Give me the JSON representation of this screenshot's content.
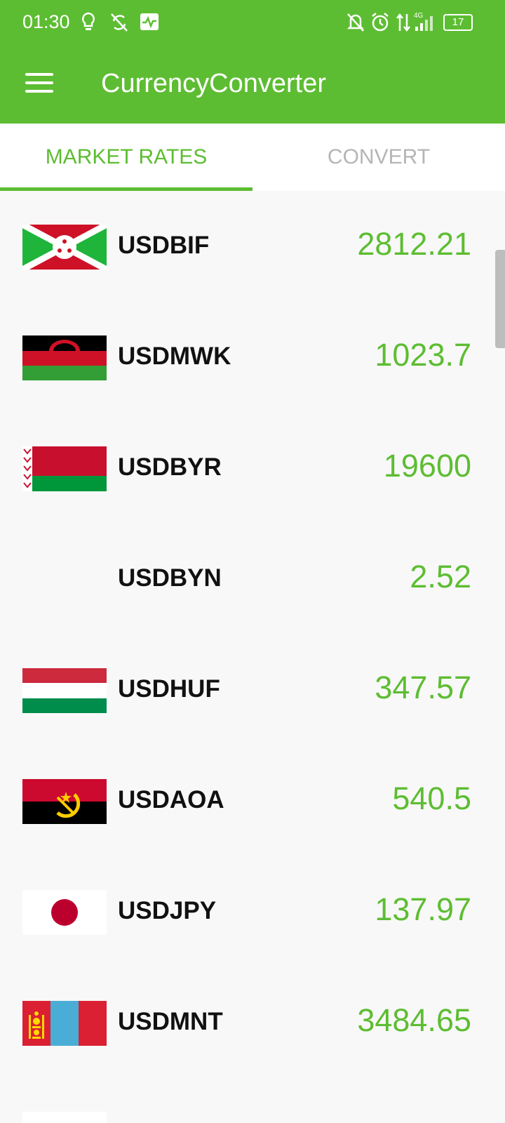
{
  "status_bar": {
    "time": "01:30",
    "battery": "17",
    "network": "4G",
    "icons": [
      "bulb-icon",
      "sync-off-icon",
      "activity-icon",
      "bell-off-icon",
      "alarm-icon",
      "data-transfer-icon",
      "signal-icon",
      "battery-icon"
    ]
  },
  "appbar": {
    "title": "CurrencyConverter",
    "menu_icon": "hamburger-menu-icon"
  },
  "tabs": [
    {
      "label": "MARKET RATES",
      "active": true
    },
    {
      "label": "CONVERT",
      "active": false
    }
  ],
  "rates": [
    {
      "code": "USDBIF",
      "value": "2812.21",
      "flag": "burundi-flag-icon"
    },
    {
      "code": "USDMWK",
      "value": "1023.7",
      "flag": "malawi-flag-icon"
    },
    {
      "code": "USDBYR",
      "value": "19600",
      "flag": "belarus-flag-icon"
    },
    {
      "code": "USDBYN",
      "value": "2.52",
      "flag": ""
    },
    {
      "code": "USDHUF",
      "value": "347.57",
      "flag": "hungary-flag-icon"
    },
    {
      "code": "USDAOA",
      "value": "540.5",
      "flag": "angola-flag-icon"
    },
    {
      "code": "USDJPY",
      "value": "137.97",
      "flag": "japan-flag-icon"
    },
    {
      "code": "USDMNT",
      "value": "3484.65",
      "flag": "mongolia-flag-icon"
    }
  ],
  "colors": {
    "accent": "#5dbd32",
    "background": "#f8f8f8",
    "inactive_tab": "#b5b5b5"
  }
}
